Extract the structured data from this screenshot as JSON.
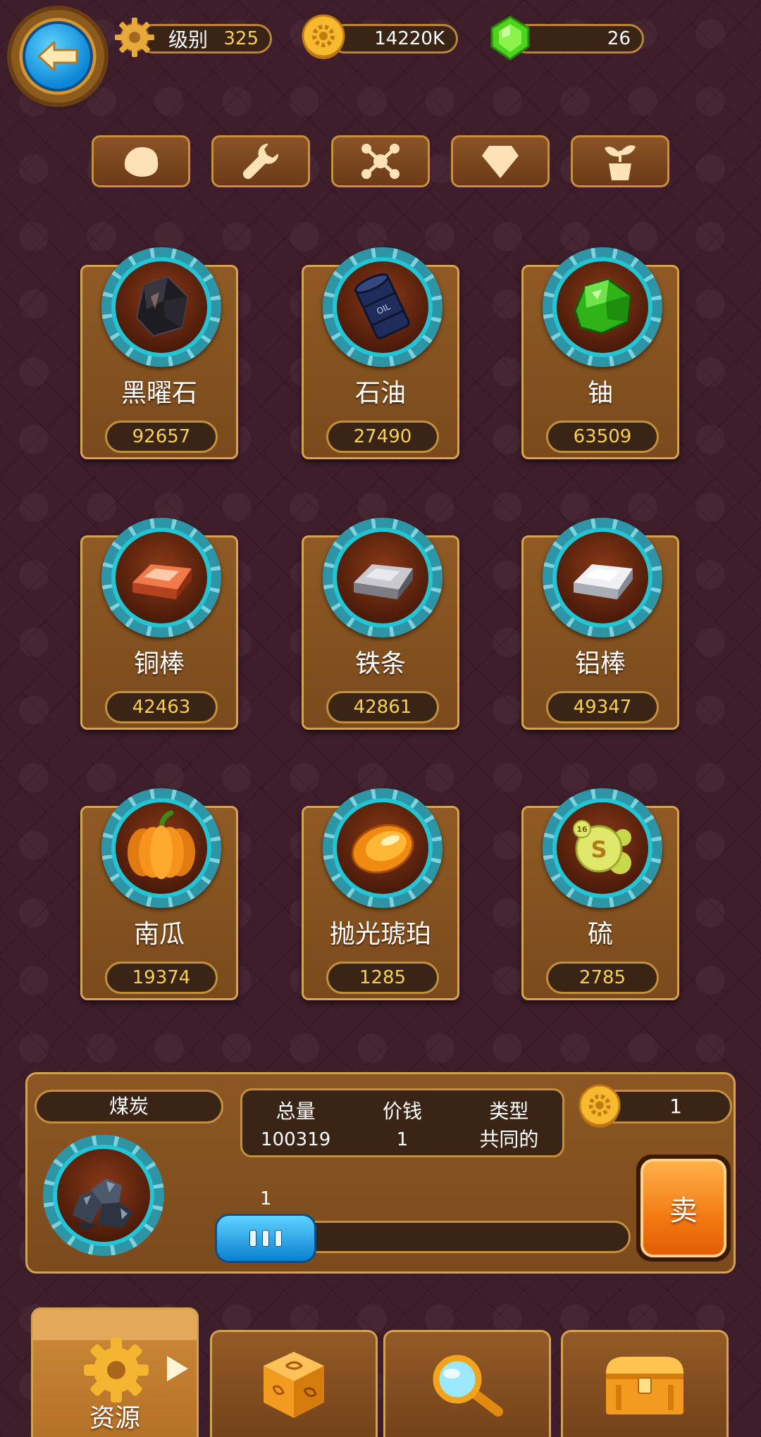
{
  "header": {
    "level_label": "级别",
    "level_value": "325",
    "coins": "14220K",
    "gems": "26"
  },
  "categories": [
    {
      "icon": "rock-icon"
    },
    {
      "icon": "wrench-icon"
    },
    {
      "icon": "molecule-icon"
    },
    {
      "icon": "diamond-icon"
    },
    {
      "icon": "sprout-icon"
    }
  ],
  "resources": [
    {
      "name": "黑曜石",
      "count": "92657",
      "icon": "obsidian-icon"
    },
    {
      "name": "石油",
      "count": "27490",
      "icon": "oil-barrel-icon"
    },
    {
      "name": "铀",
      "count": "63509",
      "icon": "uranium-icon"
    },
    {
      "name": "铜棒",
      "count": "42463",
      "icon": "copper-bar-icon"
    },
    {
      "name": "铁条",
      "count": "42861",
      "icon": "iron-bar-icon"
    },
    {
      "name": "铝棒",
      "count": "49347",
      "icon": "aluminum-bar-icon"
    },
    {
      "name": "南瓜",
      "count": "19374",
      "icon": "pumpkin-icon"
    },
    {
      "name": "抛光琥珀",
      "count": "1285",
      "icon": "amber-icon"
    },
    {
      "name": "硫",
      "count": "2785",
      "icon": "sulfur-icon"
    }
  ],
  "detail": {
    "name": "煤炭",
    "total_label": "总量",
    "total_value": "100319",
    "price_label": "价钱",
    "price_value": "1",
    "type_label": "类型",
    "type_value": "共同的",
    "unit_price": "1",
    "quantity": "1",
    "quantity_fraction": 0,
    "sell_label": "卖"
  },
  "nav": {
    "resources_label": "资源"
  },
  "colors": {
    "accent_gold": "#d8a350",
    "count_yellow": "#f6d155",
    "gear_cyan": "#23c4d4",
    "button_blue": "#0c86d6",
    "sell_orange": "#f27a12"
  }
}
